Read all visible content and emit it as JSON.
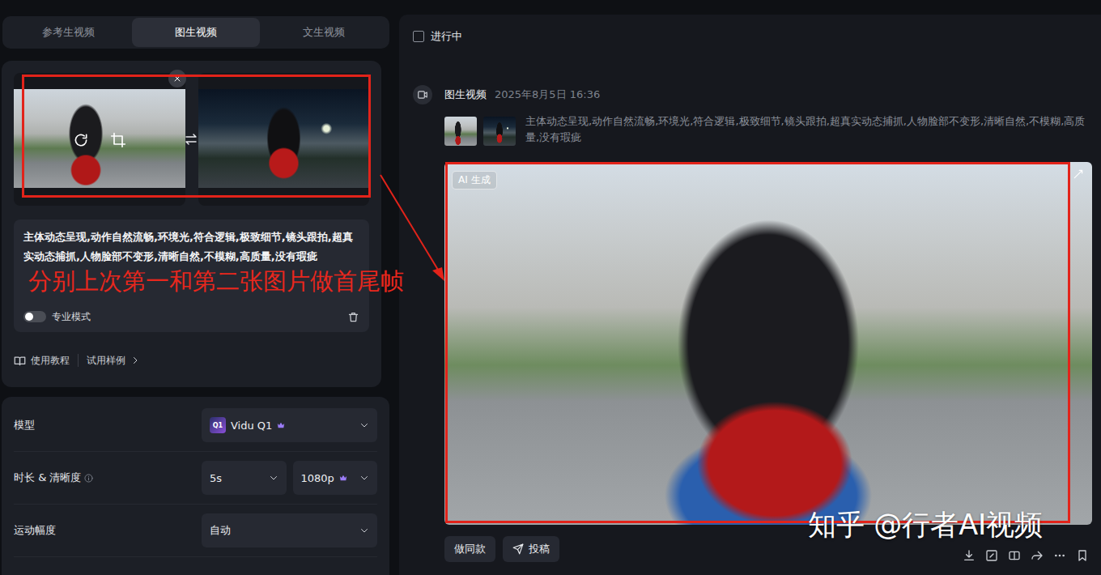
{
  "tabs": [
    {
      "label": "参考生视频",
      "selected": false
    },
    {
      "label": "图生视频",
      "selected": true
    },
    {
      "label": "文生视频",
      "selected": false
    }
  ],
  "prompt": {
    "text": "主体动态呈现,动作自然流畅,环境光,符合逻辑,极致细节,镜头跟拍,超真实动态捕抓,人物脸部不变形,清晰自然,不模糊,高质量,没有瑕疵",
    "annotation": "分别上次第一和第二张图片做首尾帧"
  },
  "pro_mode": {
    "label": "专业模式",
    "on": false
  },
  "links": [
    {
      "label": "使用教程"
    },
    {
      "label": "试用样例"
    }
  ],
  "settings": [
    {
      "label": "模型",
      "info": false,
      "values": [
        {
          "text": "Vidu Q1",
          "logo": "Q1",
          "premium": true
        }
      ]
    },
    {
      "label": "时长 & 清晰度",
      "info": true,
      "values": [
        {
          "text": "5s",
          "premium": false
        },
        {
          "text": "1080p",
          "premium": true
        }
      ]
    },
    {
      "label": "运动幅度",
      "info": false,
      "values": [
        {
          "text": "自动",
          "premium": false
        }
      ]
    }
  ],
  "in_progress": {
    "label": "进行中",
    "checked": false
  },
  "history": [
    {
      "type": "图生视频",
      "time": "2025年8月5日 16:36",
      "prompt": "主体动态呈现,动作自然流畅,环境光,符合逻辑,极致细节,镜头跟拍,超真实动态捕抓,人物脸部不变形,清晰自然,不模糊,高质量,没有瑕疵",
      "badge": "AI 生成",
      "buttons": [
        {
          "label": "做同款"
        },
        {
          "label": "投稿"
        }
      ]
    }
  ],
  "watermark": "知乎 @行者AI视频"
}
